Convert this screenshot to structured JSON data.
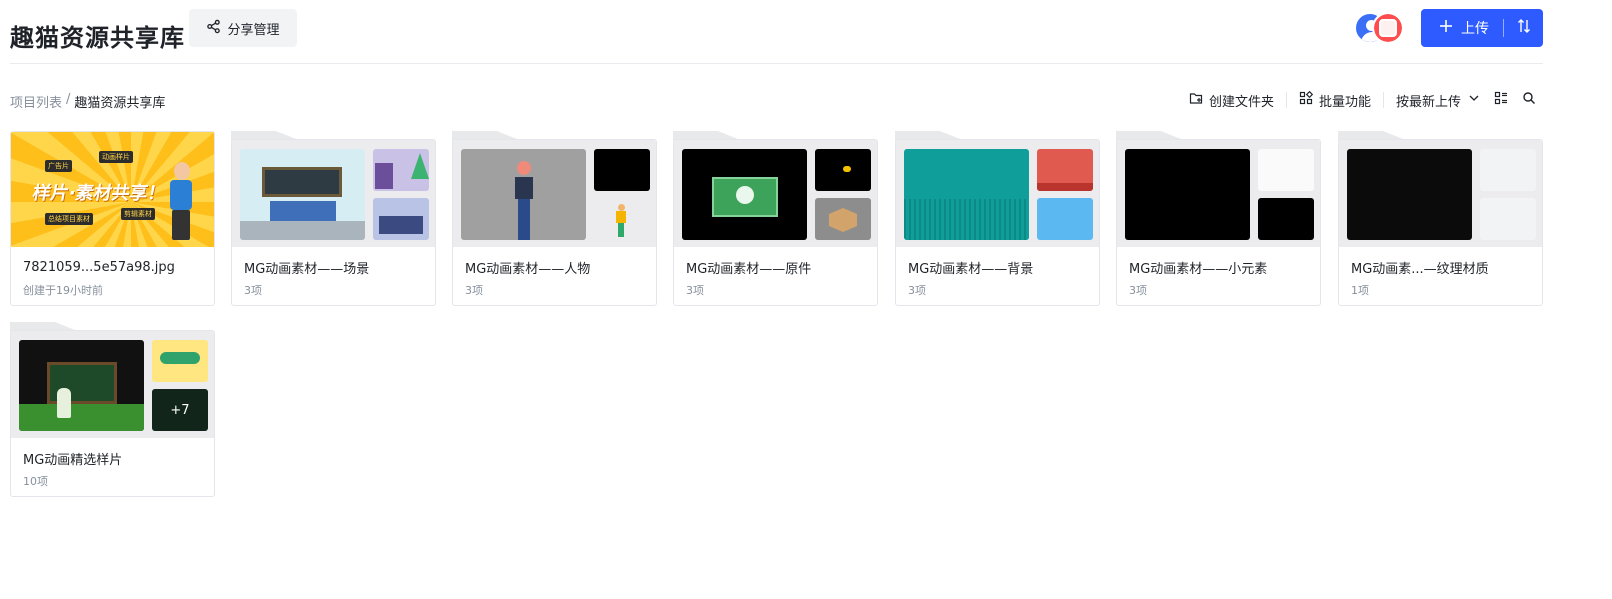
{
  "header": {
    "title": "趣猫资源共享库",
    "share_button": "分享管理",
    "upload_button": "上传"
  },
  "breadcrumb": {
    "root": "项目列表",
    "separator": "/",
    "current": "趣猫资源共享库"
  },
  "toolbar": {
    "create_folder": "创建文件夹",
    "batch": "批量功能",
    "sort": "按最新上传"
  },
  "colors": {
    "accent": "#2d5bff",
    "muted_text": "#86909c",
    "thumb_bg": "#ececee"
  },
  "items": [
    {
      "name": "7821059...5e57a98.jpg",
      "meta": "创建于19小时前",
      "kind": "image"
    },
    {
      "name": "MG动画素材——场景",
      "meta": "3项",
      "kind": "folder"
    },
    {
      "name": "MG动画素材——人物",
      "meta": "3项",
      "kind": "folder"
    },
    {
      "name": "MG动画素材——原件",
      "meta": "3项",
      "kind": "folder"
    },
    {
      "name": "MG动画素材——背景",
      "meta": "3项",
      "kind": "folder"
    },
    {
      "name": "MG动画素材——小元素",
      "meta": "3项",
      "kind": "folder"
    },
    {
      "name": "MG动画素...—纹理材质",
      "meta": "1项",
      "kind": "folder"
    },
    {
      "name": "MG动画精选样片",
      "meta": "10项",
      "kind": "folder",
      "more": "+7"
    }
  ],
  "image_preview": {
    "headline": "样片·素材共享！",
    "tag1": "广告片",
    "tag2": "动画样片",
    "tag3": "剪辑素材",
    "tag4": "总结项目素材"
  }
}
